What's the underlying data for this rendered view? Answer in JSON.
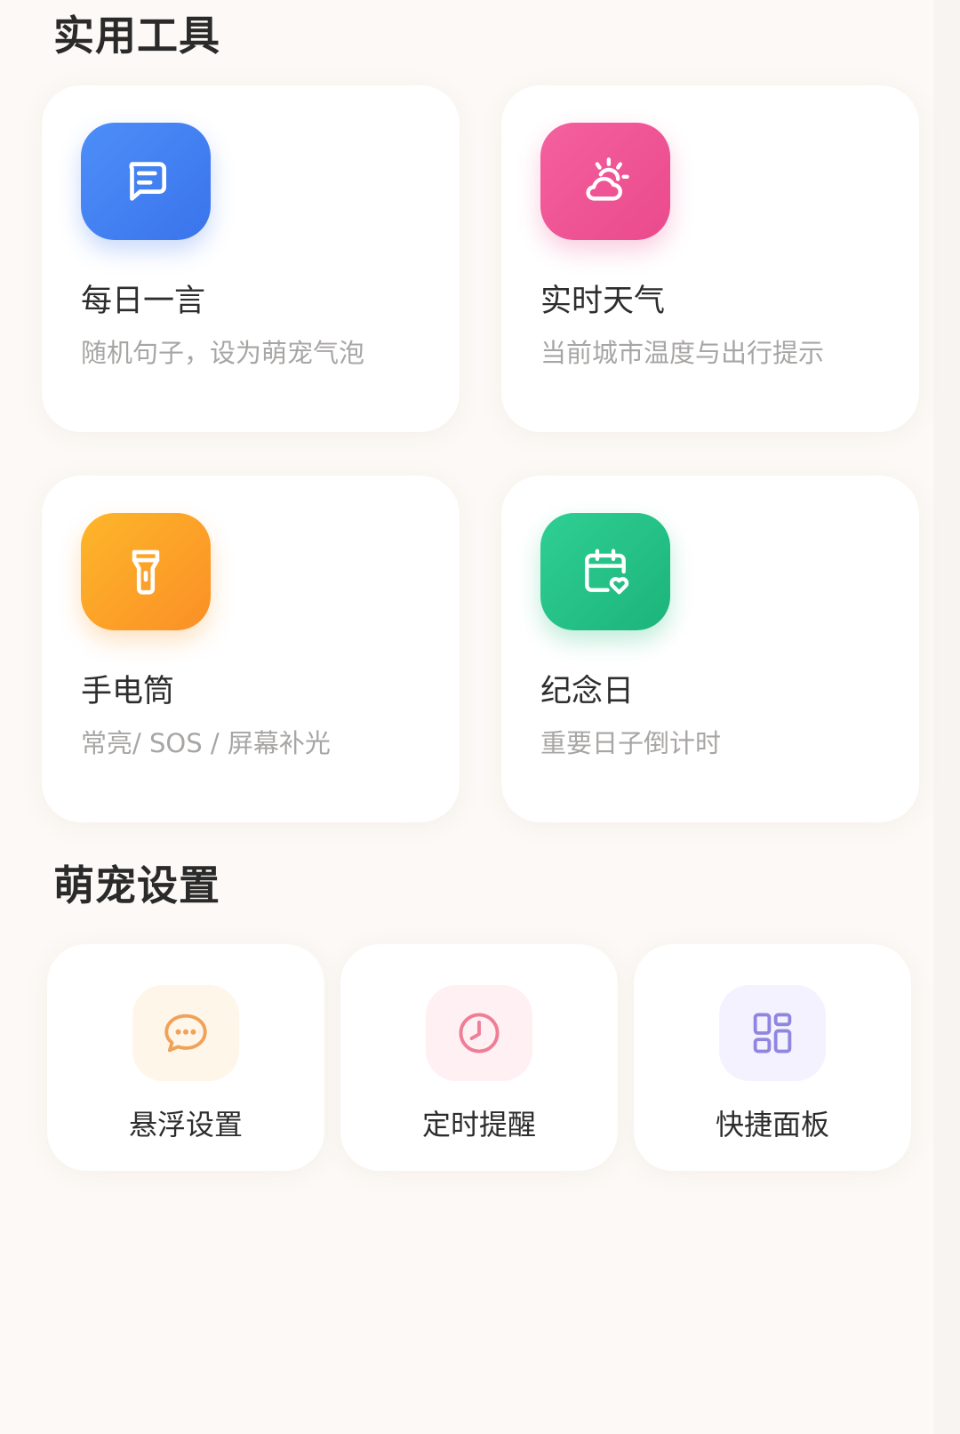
{
  "sections": {
    "tools_title": "实用工具",
    "pet_title": "萌宠设置"
  },
  "tools": [
    {
      "title": "每日一言",
      "desc": "随机句子，设为萌宠气泡",
      "icon": "message-lines-icon",
      "color": "#3f7ef2"
    },
    {
      "title": "实时天气",
      "desc": "当前城市温度与出行提示",
      "icon": "sun-cloud-icon",
      "color": "#ef5597"
    },
    {
      "title": "手电筒",
      "desc": "常亮/ SOS / 屏幕补光",
      "icon": "flashlight-icon",
      "color": "#fca128"
    },
    {
      "title": "纪念日",
      "desc": "重要日子倒计时",
      "icon": "calendar-heart-icon",
      "color": "#25c187"
    }
  ],
  "settings": [
    {
      "label": "悬浮设置",
      "icon": "chat-bubble-icon",
      "color": "#f0a25a"
    },
    {
      "label": "定时提醒",
      "icon": "clock-icon",
      "color": "#ef7d96"
    },
    {
      "label": "快捷面板",
      "icon": "grid-panel-icon",
      "color": "#8f86e0"
    }
  ]
}
